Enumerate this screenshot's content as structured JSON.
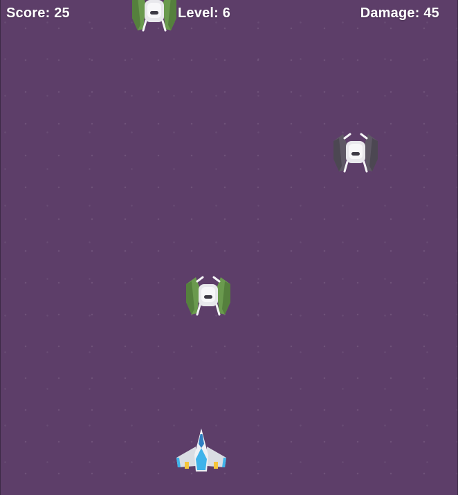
{
  "hud": {
    "score_label": "Score: 25",
    "level_label": "Level: 6",
    "damage_label": "Damage: 45"
  },
  "colors": {
    "background": "#5d3e69",
    "enemy_green": "#6a9a4e",
    "enemy_gray": "#5e5865",
    "enemy_body": "#e8e8ec",
    "player_blue": "#3fb3ea",
    "player_hull": "#d9dde3",
    "player_thruster": "#f5c53a"
  },
  "sprites": {
    "enemies": [
      {
        "name": "green-enemy-ship-icon",
        "color": "green"
      },
      {
        "name": "gray-enemy-ship-icon",
        "color": "gray"
      },
      {
        "name": "green-enemy-ship-icon",
        "color": "green"
      }
    ],
    "player": {
      "name": "player-ship-icon"
    }
  }
}
